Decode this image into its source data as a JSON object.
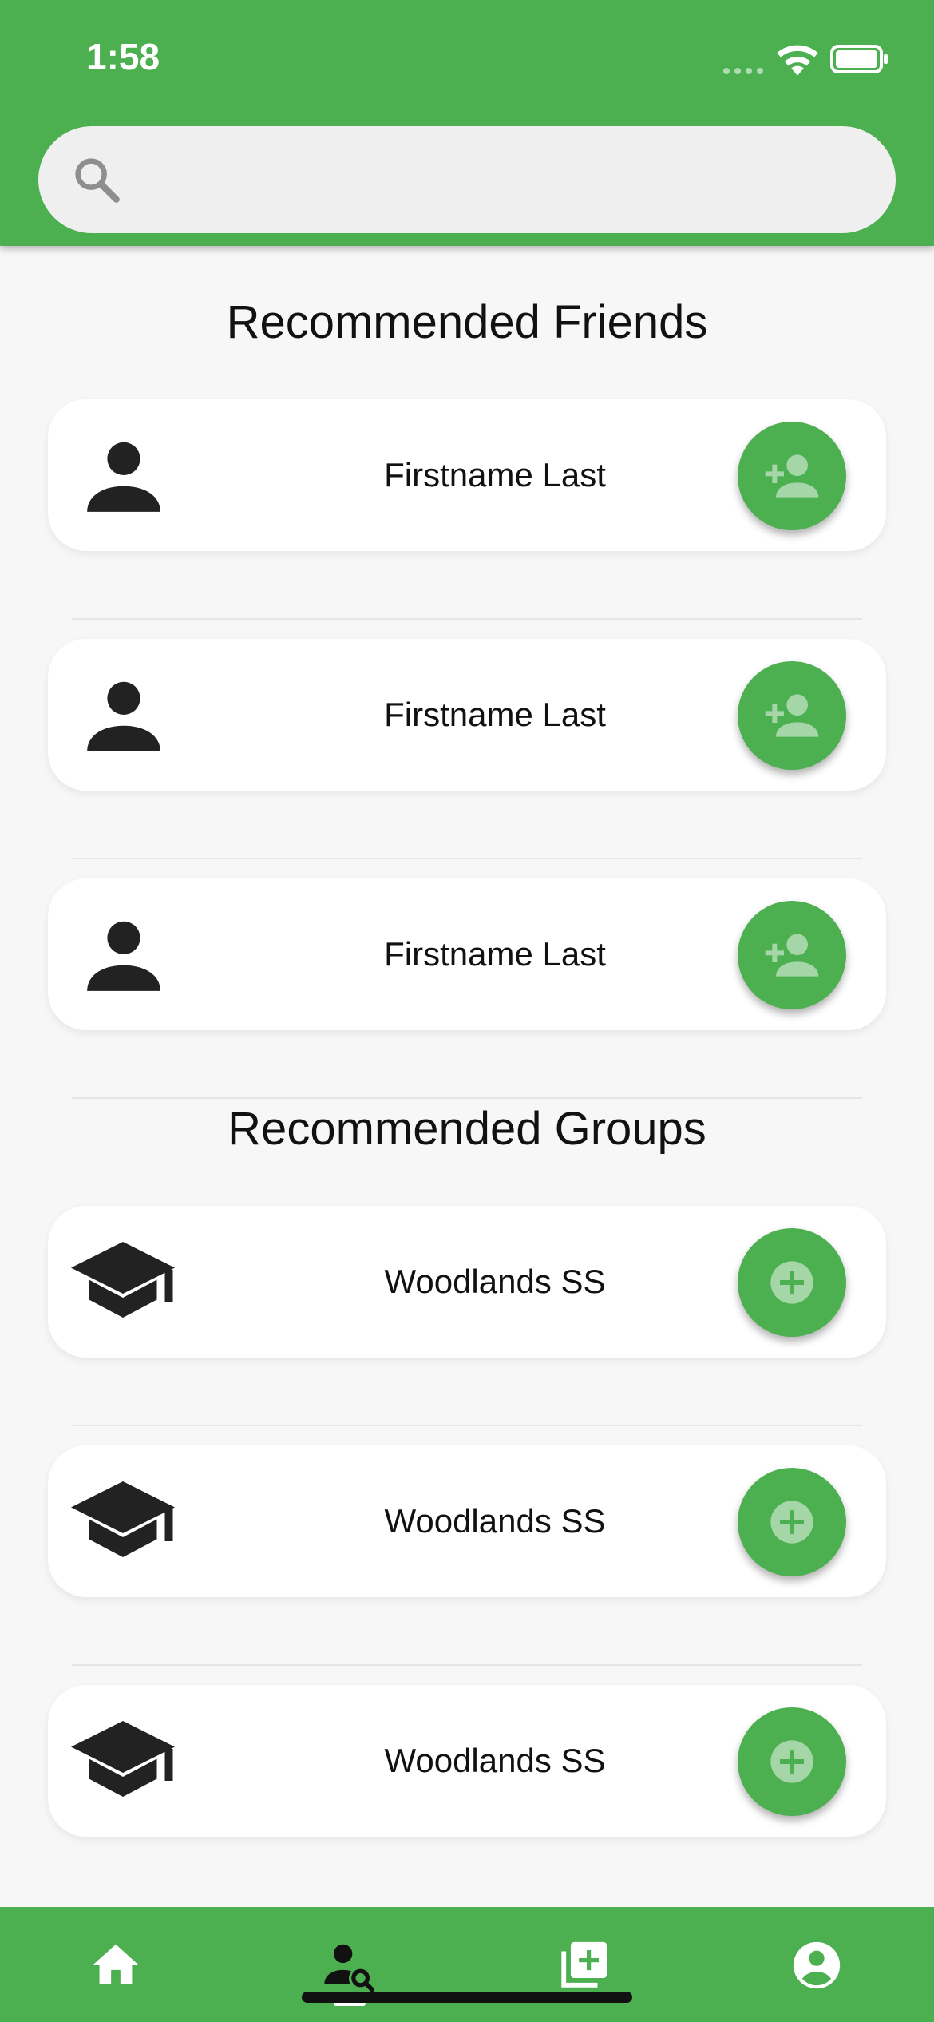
{
  "status_bar": {
    "time": "1:58"
  },
  "search": {
    "placeholder": "",
    "value": ""
  },
  "friends": {
    "title": "Recommended Friends",
    "items": [
      {
        "name": "Firstname Last"
      },
      {
        "name": "Firstname Last"
      },
      {
        "name": "Firstname Last"
      }
    ]
  },
  "groups": {
    "title": "Recommended Groups",
    "items": [
      {
        "name": "Woodlands SS"
      },
      {
        "name": "Woodlands SS"
      },
      {
        "name": "Woodlands SS"
      }
    ]
  },
  "bottom_nav": {
    "items": [
      {
        "icon": "home-icon",
        "active": false
      },
      {
        "icon": "person-search-icon",
        "active": true
      },
      {
        "icon": "add-library-icon",
        "active": false
      },
      {
        "icon": "account-circle-icon",
        "active": false
      }
    ]
  },
  "colors": {
    "brand": "#4caf50",
    "background": "#f7f7f7",
    "card": "#ffffff"
  }
}
